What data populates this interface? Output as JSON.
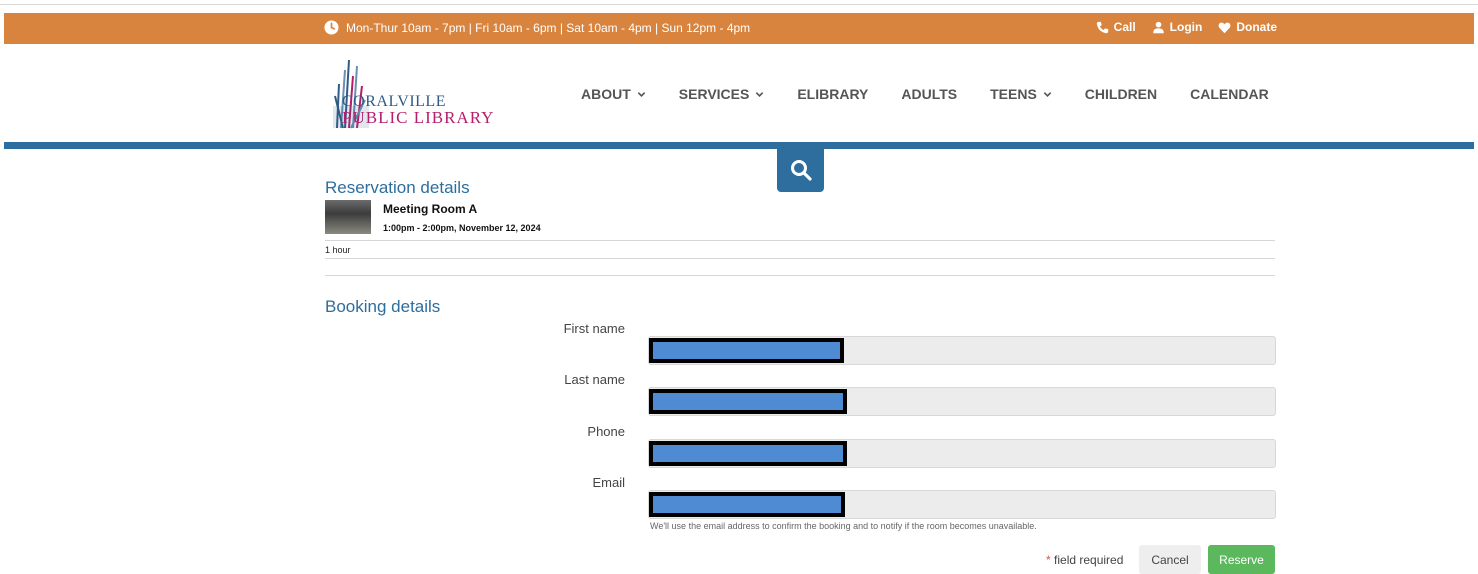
{
  "topbar": {
    "hours": "Mon-Thur 10am - 7pm | Fri 10am - 6pm | Sat 10am - 4pm | Sun 12pm - 4pm",
    "call": "Call",
    "login": "Login",
    "donate": "Donate",
    "bg_color": "#d9843e"
  },
  "logo": {
    "line1": "CORALVILLE",
    "line2": "PUBLIC LIBRARY"
  },
  "nav": {
    "about": "ABOUT",
    "services": "SERVICES",
    "elibrary": "ELIBRARY",
    "adults": "ADULTS",
    "teens": "TEENS",
    "children": "CHILDREN",
    "calendar": "CALENDAR"
  },
  "reservation": {
    "title": "Reservation details",
    "room": "Meeting Room A",
    "time": "1:00pm - 2:00pm, November 12, 2024",
    "duration": "1 hour"
  },
  "booking": {
    "title": "Booking details",
    "first_name_label": "First name",
    "last_name_label": "Last name",
    "phone_label": "Phone",
    "email_label": "Email",
    "email_help": "We'll use the email address to confirm the booking and to notify if the room becomes unavailable.",
    "required_star": "*",
    "required_text": "field required",
    "cancel": "Cancel",
    "reserve": "Reserve"
  },
  "colors": {
    "accent_blue": "#2d6e9e",
    "reserve_green": "#5cb85c"
  }
}
